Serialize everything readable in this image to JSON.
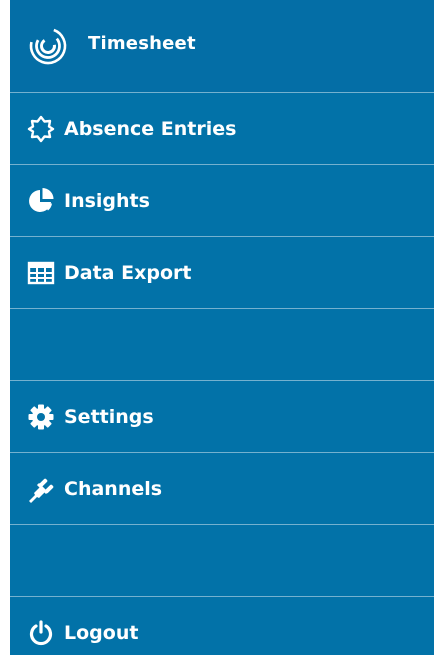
{
  "header": {
    "title": "Timesheet",
    "logo_icon": "timesheet-spiral-logo"
  },
  "menu": {
    "absence": {
      "label": "Absence Entries",
      "icon": "sun-outline-icon"
    },
    "insights": {
      "label": "Insights",
      "icon": "pie-chart-icon"
    },
    "export": {
      "label": "Data Export",
      "icon": "table-grid-icon"
    },
    "settings": {
      "label": "Settings",
      "icon": "gear-icon"
    },
    "channels": {
      "label": "Channels",
      "icon": "plug-icon"
    },
    "logout": {
      "label": "Logout",
      "icon": "power-icon"
    }
  },
  "colors": {
    "background": "#0272a8",
    "header": "#046ea6",
    "text": "#ffffff",
    "divider": "#8fc1dc"
  }
}
